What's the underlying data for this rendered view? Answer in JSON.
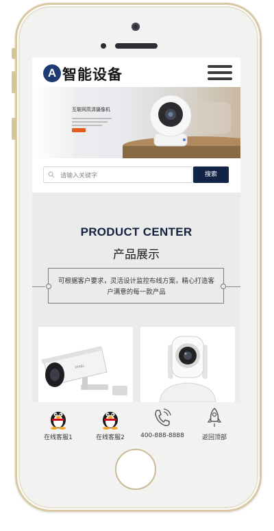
{
  "header": {
    "logo_letter": "A",
    "brand": "智能设备"
  },
  "banner": {
    "title": "互联网高清摄像机",
    "subtitle": ""
  },
  "search": {
    "placeholder": "请输入关键字",
    "button": "搜索"
  },
  "section": {
    "title_en": "PRODUCT CENTER",
    "title_cn": "产品展示",
    "description": "可根据客户要求，灵活设计监控布线方案，精心打造客户满意的每一款产品"
  },
  "bottom_bar": [
    {
      "label": "在线客服1",
      "icon": "qq-penguin-icon"
    },
    {
      "label": "在线客服2",
      "icon": "qq-penguin-icon"
    },
    {
      "label": "400-888-8888",
      "icon": "phone-icon"
    },
    {
      "label": "返回顶部",
      "icon": "rocket-icon"
    }
  ],
  "colors": {
    "brand_navy": "#122348",
    "logo_blue": "#1e3a72",
    "phone_gold": "#d9c9a3"
  }
}
